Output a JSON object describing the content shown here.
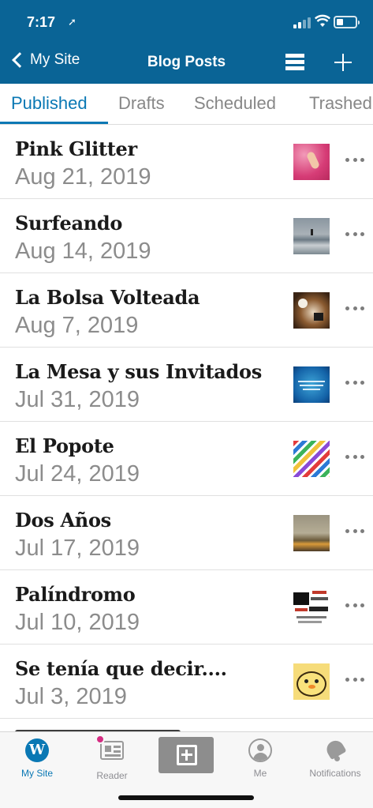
{
  "status_bar": {
    "time": "7:17"
  },
  "nav": {
    "back_label": "My Site",
    "title": "Blog Posts"
  },
  "tabs": [
    {
      "label": "Published",
      "active": true
    },
    {
      "label": "Drafts",
      "active": false
    },
    {
      "label": "Scheduled",
      "active": false
    },
    {
      "label": "Trashed",
      "active": false
    }
  ],
  "posts": [
    {
      "title": "Pink Glitter",
      "date": "Aug 21, 2019"
    },
    {
      "title": "Surfeando",
      "date": "Aug 14, 2019"
    },
    {
      "title": "La Bolsa Volteada",
      "date": "Aug 7, 2019"
    },
    {
      "title": "La Mesa y sus Invitados",
      "date": "Jul 31, 2019"
    },
    {
      "title": "El Popote",
      "date": "Jul 24, 2019"
    },
    {
      "title": "Dos Años",
      "date": "Jul 17, 2019"
    },
    {
      "title": "Palíndromo",
      "date": "Jul 10, 2019"
    },
    {
      "title": "Se tenía que decir....",
      "date": "Jul 3, 2019"
    }
  ],
  "tab_bar": {
    "my_site": "My Site",
    "reader": "Reader",
    "me": "Me",
    "notifications": "Notifications"
  },
  "colors": {
    "brand_blue": "#0a6496",
    "accent": "#0a78b4",
    "notification_dot": "#d52c82"
  }
}
